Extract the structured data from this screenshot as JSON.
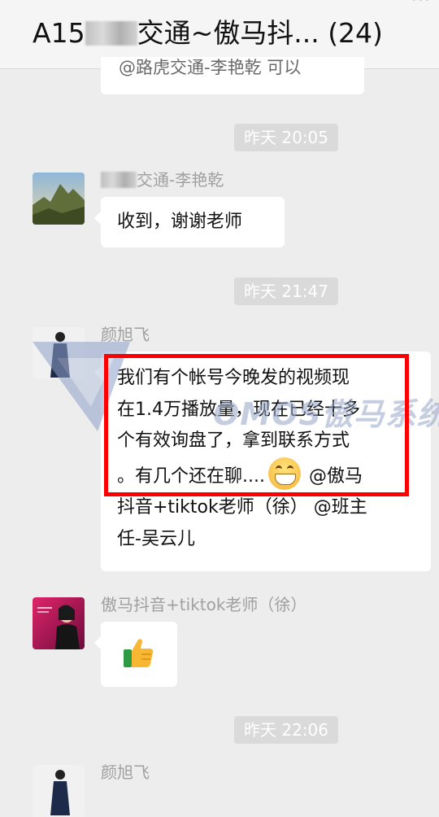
{
  "header": {
    "title_prefix": "A15",
    "title_suffix": "交通~傲马抖... (24)",
    "more": "···"
  },
  "messages": {
    "top_partial_text": "@路虎交通-李艳乾 可以",
    "time1": "昨天 20:05",
    "msg1": {
      "sender": "交通-李艳乾",
      "text": "收到，谢谢老师"
    },
    "time2": "昨天 21:47",
    "msg2": {
      "sender": "颜旭飞",
      "line1": "我们有个帐号今晚发的视频现",
      "line2": "在1.4万播放量，现在已经十多",
      "line3": "个有效询盘了，拿到联系方式",
      "line4a": "。有几个还在聊....",
      "line4b": "@傲马",
      "line5": "抖音+tiktok老师（徐） @班主",
      "line6": "任-吴云儿"
    },
    "msg3": {
      "sender": "傲马抖音+tiktok老师（徐）",
      "emoji": "thumbs-up"
    },
    "time3": "昨天 22:06",
    "msg4": {
      "sender": "颜旭飞"
    }
  },
  "watermark": {
    "text": "OMOS傲马系统"
  },
  "colors": {
    "background": "#ededed",
    "header_bg": "#f5f5f5",
    "bubble": "#ffffff",
    "highlight_box": "#ff0000",
    "timestamp_bg": "#dadada"
  }
}
